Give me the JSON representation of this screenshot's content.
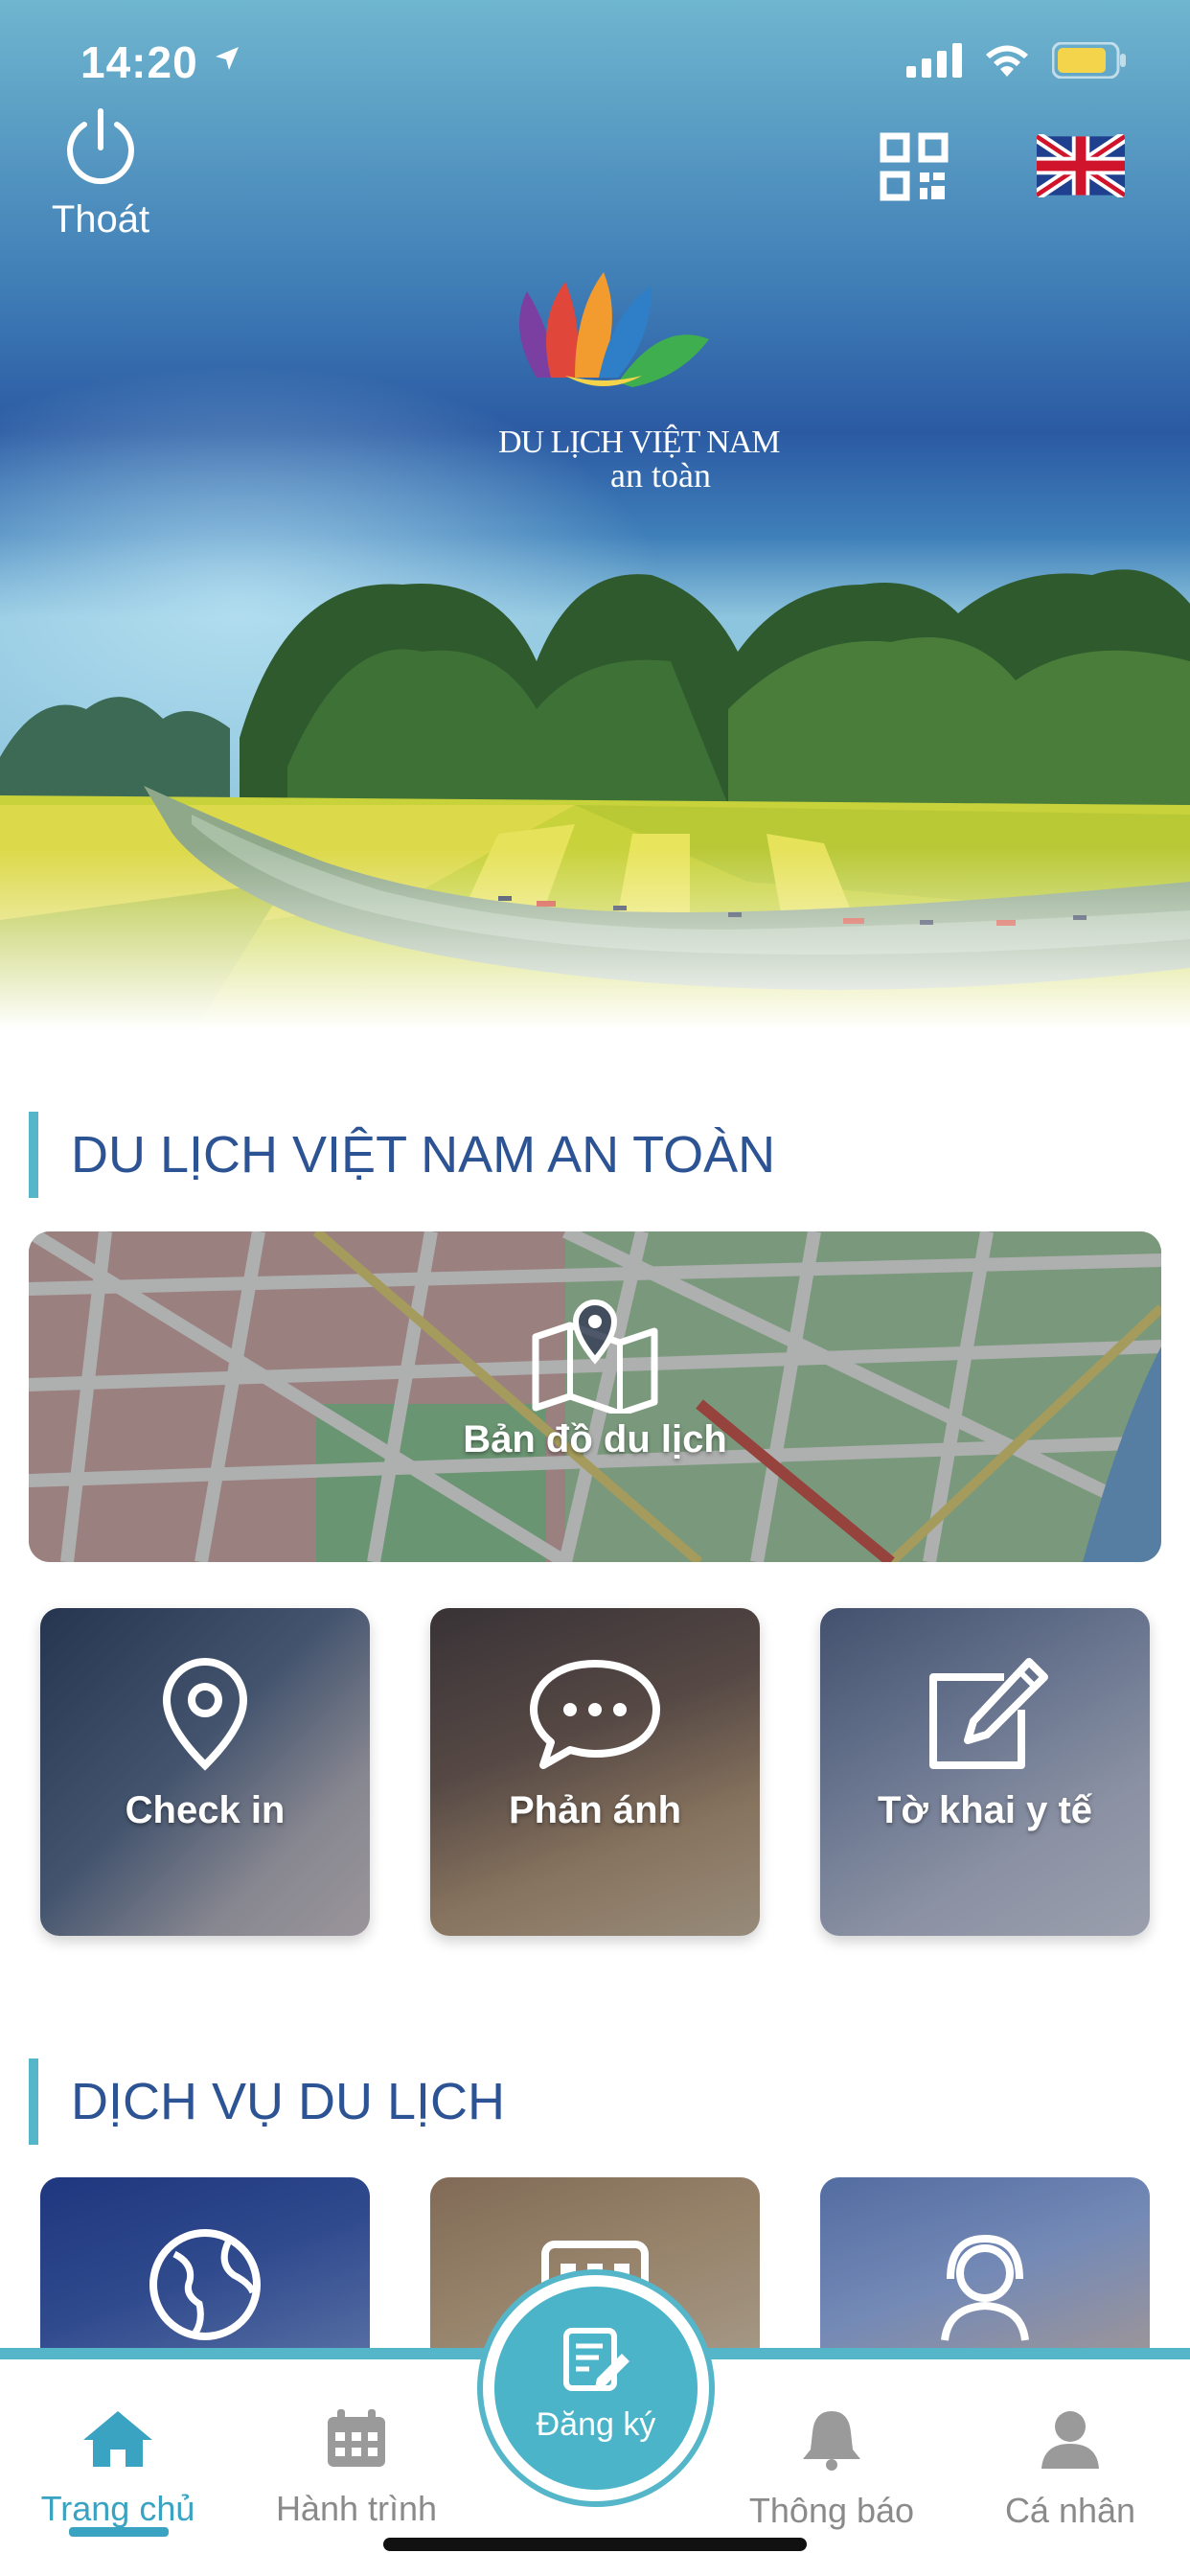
{
  "status_bar": {
    "time": "14:20"
  },
  "header": {
    "logout_label": "Thoát",
    "brand_line1": "DU LỊCH VIỆT NAM",
    "brand_line2": "an toàn"
  },
  "section_safe": {
    "title": "DU LỊCH VIỆT NAM AN TOÀN",
    "map_card_label": "Bản đồ du lịch",
    "tiles": [
      {
        "label": "Check in",
        "icon": "location-pin-icon"
      },
      {
        "label": "Phản ánh",
        "icon": "chat-bubble-icon"
      },
      {
        "label": "Tờ  khai y tế",
        "icon": "edit-form-icon"
      }
    ]
  },
  "section_services": {
    "title": "DỊCH VỤ DU LỊCH",
    "tile_icons": [
      "globe-icon",
      "calendar-grid-icon",
      "support-agent-icon"
    ]
  },
  "tabbar": {
    "items": [
      {
        "label": "Trang chủ",
        "icon": "home-icon",
        "active": true
      },
      {
        "label": "Hành trình",
        "icon": "calendar-icon",
        "active": false
      },
      {
        "label": "Thông báo",
        "icon": "bell-icon",
        "active": false
      },
      {
        "label": "Cá nhân",
        "icon": "user-icon",
        "active": false
      }
    ],
    "register_label": "Đăng ký"
  },
  "colors": {
    "accent": "#55b6c9",
    "title_blue": "#2c5494",
    "active_tab": "#3aa3c2",
    "inactive_tab": "#8a8a8a"
  }
}
